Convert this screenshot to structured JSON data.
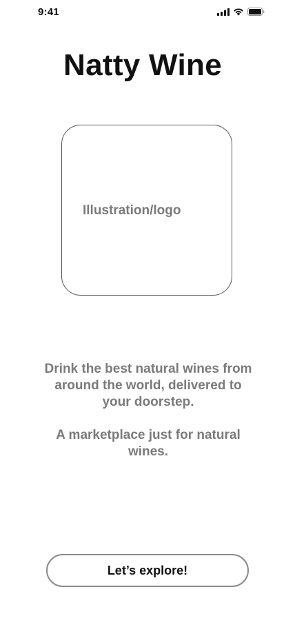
{
  "status_bar": {
    "time": "9:41",
    "icons": [
      "cellular-signal-icon",
      "wifi-icon",
      "battery-icon"
    ]
  },
  "app": {
    "title": "Natty Wine"
  },
  "illustration": {
    "label": "Illustration/logo"
  },
  "tagline": {
    "line1": "Drink the best natural wines from around the world, delivered to your doorstep.",
    "line2": "A marketplace just for natural wines."
  },
  "cta": {
    "label": "Let’s explore!"
  },
  "colors": {
    "text_primary": "#111111",
    "text_secondary": "#7a7a7a",
    "border": "#8a8a8a",
    "background": "#ffffff"
  }
}
